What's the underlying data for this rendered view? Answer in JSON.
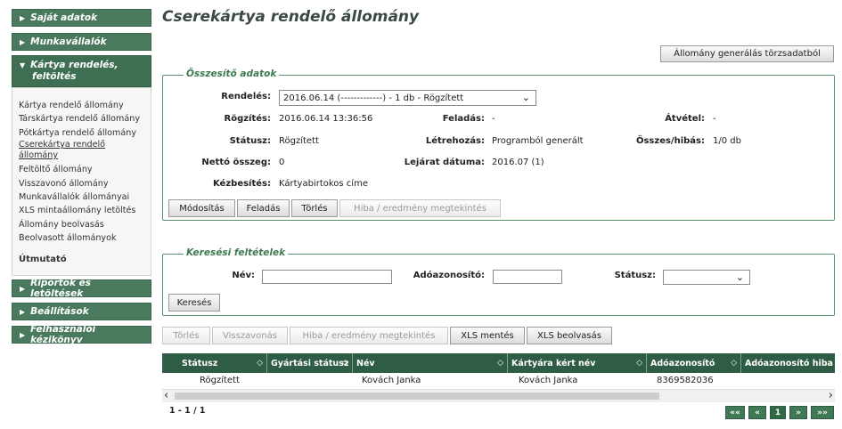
{
  "sidebar": {
    "sections_top": [
      {
        "label": "Saját adatok"
      },
      {
        "label": "Munkavállalók"
      }
    ],
    "open_section": {
      "label_line1": "Kártya rendelés,",
      "label_line2": "feltöltés"
    },
    "links": [
      "Kártya rendelő állomány",
      "Társkártya rendelő állomány",
      "Pótkártya rendelő állomány",
      "Cserekártya rendelő állomány",
      "Feltöltő állomány",
      "Visszavonó állomány",
      "Munkavállalók állományai",
      "XLS mintaállomány letöltés",
      "Állomány beolvasás",
      "Beolvasott állományok"
    ],
    "guide": "Útmutató",
    "sections_bottom": [
      {
        "label": "Riportok és letöltések"
      },
      {
        "label": "Beállítások"
      },
      {
        "label": "Felhasználói kézikönyv"
      }
    ]
  },
  "page": {
    "title": "Cserekártya rendelő állomány",
    "generate_button": "Állomány generálás törzsadatból"
  },
  "summary": {
    "legend": "Összesítő adatok",
    "order_label": "Rendelés:",
    "order_value": "2016.06.14  (-------------) -     1 db - Rögzített",
    "recorded_label": "Rögzítés:",
    "recorded_value": "2016.06.14 13:36:56",
    "dispatch_label": "Feladás:",
    "dispatch_value": "-",
    "receipt_label": "Átvétel:",
    "receipt_value": "-",
    "status_label": "Státusz:",
    "status_value": "Rögzített",
    "created_label": "Létrehozás:",
    "created_value": "Programból generált",
    "total_err_label": "Összes/hibás:",
    "total_err_value": "1/0 db",
    "net_label": "Nettó összeg:",
    "net_value": "0",
    "expiry_label": "Lejárat dátuma:",
    "expiry_value": "2016.07 (1)",
    "delivery_label": "Kézbesítés:",
    "delivery_value": "Kártyabirtokos címe",
    "buttons": {
      "modify": "Módosítás",
      "dispatch": "Feladás",
      "delete": "Törlés",
      "errors": "Hiba / eredmény megtekintés"
    }
  },
  "search": {
    "legend": "Keresési feltételek",
    "name_label": "Név:",
    "taxid_label": "Adóazonosító:",
    "status_label": "Státusz:",
    "name_value": "",
    "taxid_value": "",
    "status_value": "",
    "search_button": "Keresés"
  },
  "toolbar": {
    "delete": "Törlés",
    "revoke": "Visszavonás",
    "errors": "Hiba / eredmény megtekintés",
    "xls_save": "XLS mentés",
    "xls_load": "XLS beolvasás"
  },
  "grid": {
    "columns": [
      "Státusz",
      "Gyártási státusz",
      "Név",
      "Kártyára kért név",
      "Adóazonosító",
      "Adóazonosító hiba"
    ],
    "rows": [
      [
        "Rögzített",
        "",
        "Kovách Janka",
        "Kovách Janka",
        "8369582036",
        ""
      ]
    ],
    "counter": "1 - 1 / 1"
  },
  "pager": {
    "first": "««",
    "prev": "«",
    "current": "1",
    "next": "»",
    "last": "»»"
  },
  "colors": {
    "sidebar_header": "#4a7a5e",
    "grid_header": "#2e5c44",
    "legend_text": "#3d7a4f",
    "title_text": "#3a4a42"
  }
}
